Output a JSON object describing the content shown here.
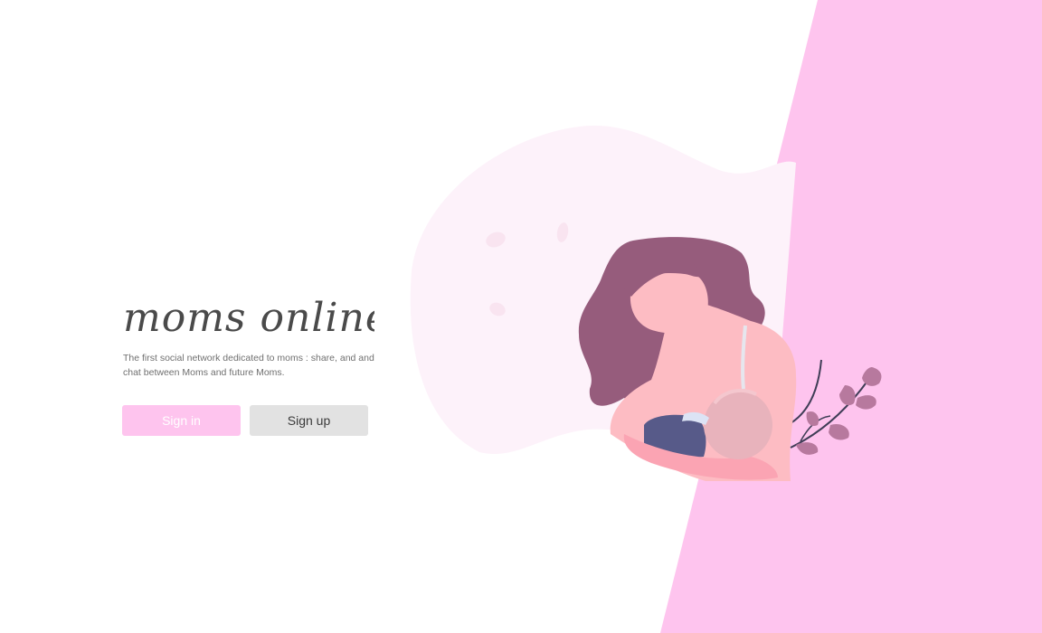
{
  "brand": {
    "logo_text": "moms online"
  },
  "hero": {
    "tagline": "The first social network dedicated to moms : share, and and chat between Moms and future Moms."
  },
  "actions": {
    "signin_label": "Sign in",
    "signup_label": "Sign up"
  },
  "theme": {
    "accent_pink": "#fec4ee",
    "blob_pink": "#fdf2fa",
    "hair_plum": "#965c7c",
    "skin": "#fdbcc3",
    "baby_clothes": "#575a89",
    "leaf": "#b7799e",
    "button_grey": "#e2e2e2"
  },
  "illustration": {
    "subject": "mother-breastfeeding-baby",
    "decoration": "leaf-branch"
  }
}
